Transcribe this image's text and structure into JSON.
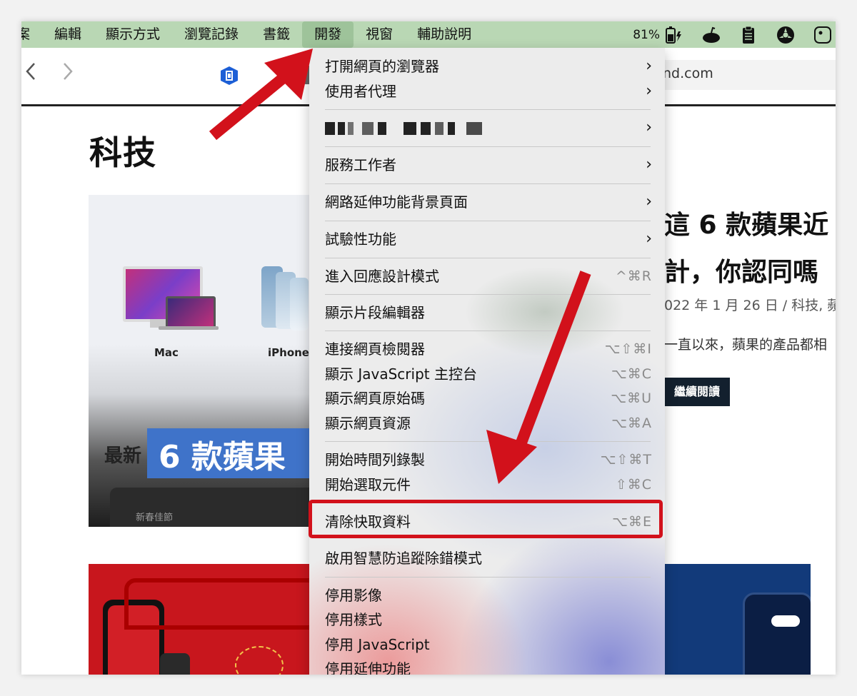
{
  "menubar": {
    "items": [
      {
        "label": "案",
        "active": false
      },
      {
        "label": "編輯",
        "active": false
      },
      {
        "label": "顯示方式",
        "active": false
      },
      {
        "label": "瀏覽記錄",
        "active": false
      },
      {
        "label": "書籤",
        "active": false
      },
      {
        "label": "開發",
        "active": true
      },
      {
        "label": "視窗",
        "active": false
      },
      {
        "label": "輔助說明",
        "active": false
      }
    ],
    "battery_percent": "81%",
    "icons": [
      "battery-charging-icon",
      "app-status-icon",
      "clipboard-icon",
      "settings-wheel-icon",
      "control-center-icon"
    ]
  },
  "browser": {
    "url_fragment": "nd.com"
  },
  "page": {
    "heading": "科技",
    "products": [
      {
        "label": "Mac"
      },
      {
        "label": "iPhone"
      }
    ],
    "featured_banner": "6 款蘋果",
    "featured_prefix": "最新",
    "featured_small": "新春佳節",
    "article_title_1": "這 6 款蘋果近",
    "article_title_2": "計，你認同嗎",
    "article_meta": "022 年 1 月 26 日 / 科技, 蘋",
    "article_excerpt": "一直以來，蘋果的產品都相",
    "read_more": "繼續閱讀"
  },
  "dev_menu": {
    "items": [
      {
        "label": "打開網頁的瀏覽器",
        "shortcut": "",
        "submenu": true
      },
      {
        "label": "使用者代理",
        "shortcut": "",
        "submenu": true
      },
      {
        "label": "",
        "shortcut": "",
        "submenu": true,
        "blurred": true
      },
      {
        "label": "服務工作者",
        "shortcut": "",
        "submenu": true
      },
      {
        "label": "網路延伸功能背景頁面",
        "shortcut": "",
        "submenu": true
      },
      {
        "label": "試驗性功能",
        "shortcut": "",
        "submenu": true
      },
      {
        "label": "進入回應設計模式",
        "shortcut": "^⌘R",
        "submenu": false
      },
      {
        "label": "顯示片段編輯器",
        "shortcut": "",
        "submenu": false
      },
      {
        "label": "連接網頁檢閱器",
        "shortcut": "⌥⇧⌘I",
        "submenu": false
      },
      {
        "label": "顯示 JavaScript 主控台",
        "shortcut": "⌥⌘C",
        "submenu": false
      },
      {
        "label": "顯示網頁原始碼",
        "shortcut": "⌥⌘U",
        "submenu": false
      },
      {
        "label": "顯示網頁資源",
        "shortcut": "⌥⌘A",
        "submenu": false
      },
      {
        "label": "開始時間列錄製",
        "shortcut": "⌥⇧⌘T",
        "submenu": false
      },
      {
        "label": "開始選取元件",
        "shortcut": "⇧⌘C",
        "submenu": false
      },
      {
        "label": "清除快取資料",
        "shortcut": "⌥⌘E",
        "submenu": false,
        "highlighted": true
      },
      {
        "label": "啟用智慧防追蹤除錯模式",
        "shortcut": "",
        "submenu": false
      },
      {
        "label": "停用影像",
        "shortcut": "",
        "submenu": false
      },
      {
        "label": "停用樣式",
        "shortcut": "",
        "submenu": false
      },
      {
        "label": "停用 JavaScript",
        "shortcut": "",
        "submenu": false
      },
      {
        "label": "停用延伸功能",
        "shortcut": "",
        "submenu": false
      }
    ],
    "chevron": "›",
    "highlight_color": "#d2111b"
  },
  "annotations": {
    "arrow_color": "#d2111b"
  }
}
